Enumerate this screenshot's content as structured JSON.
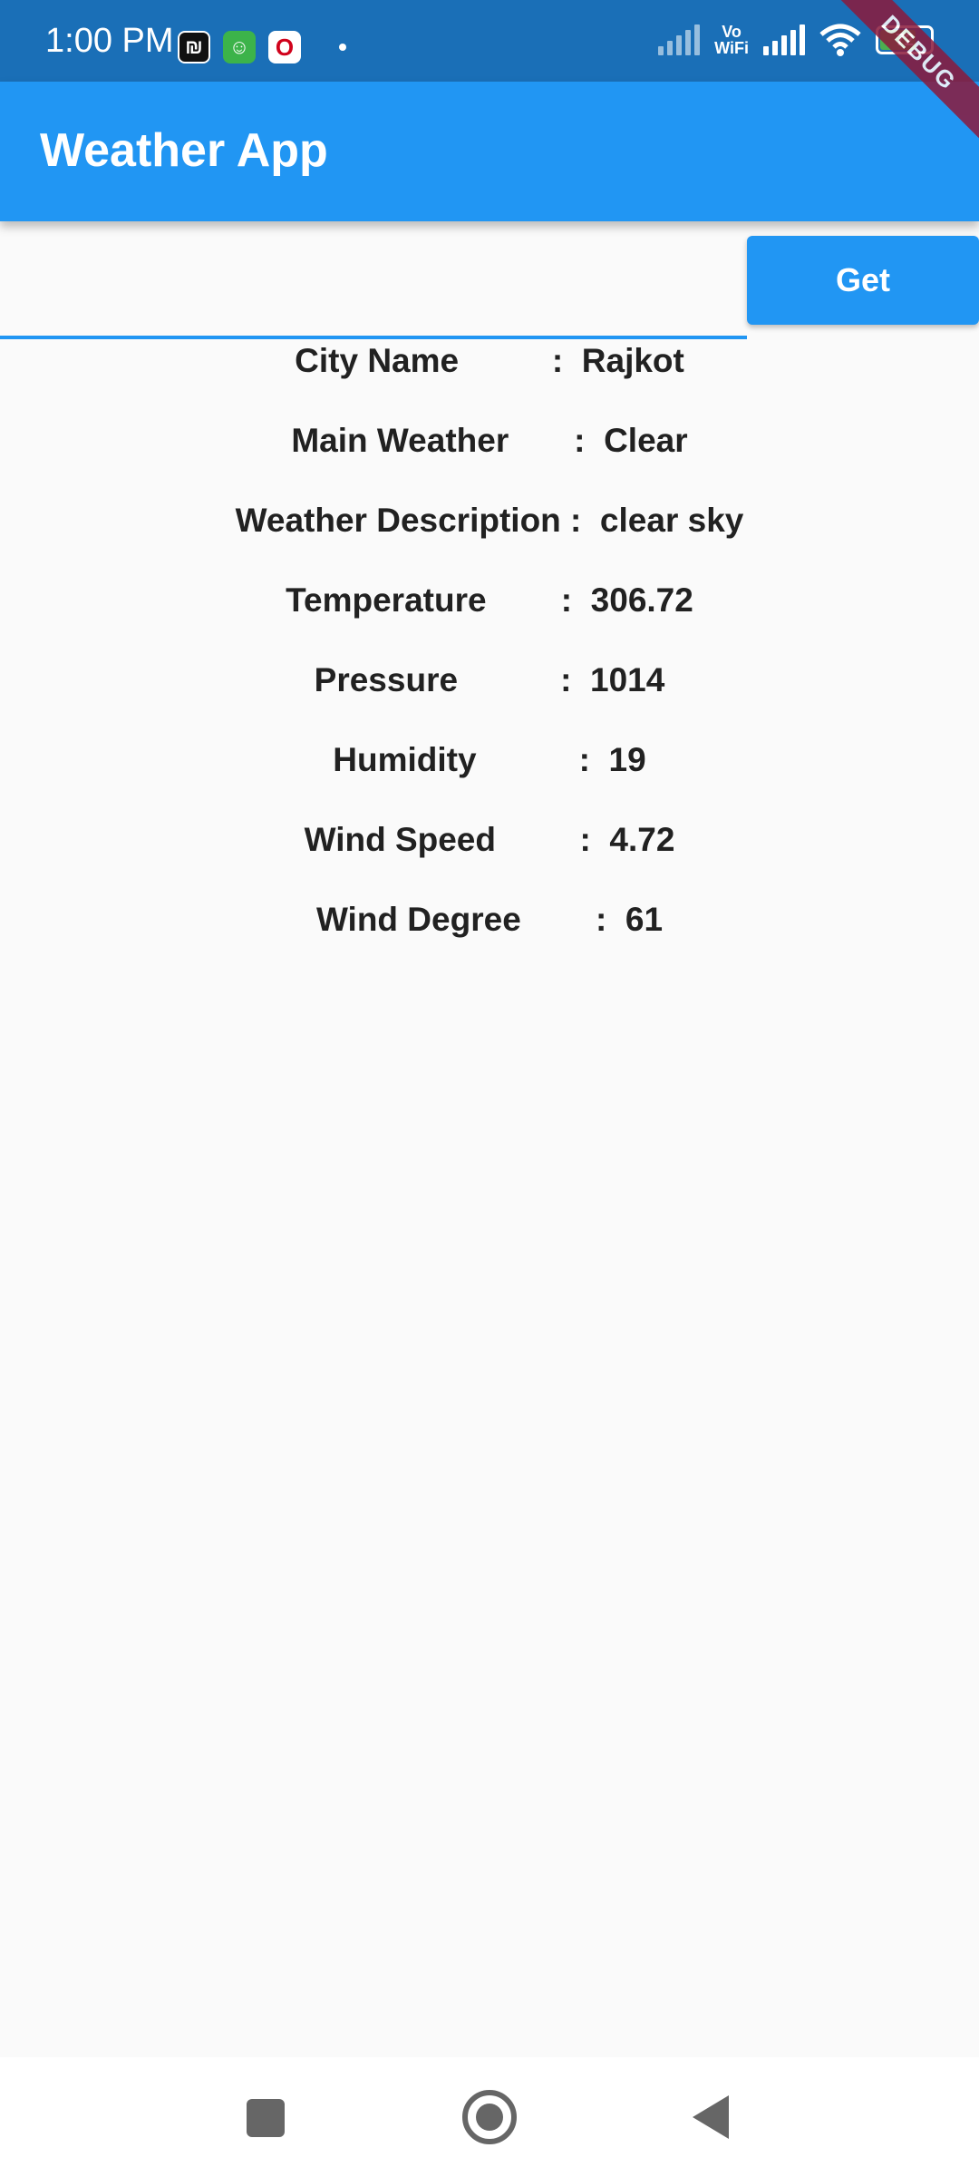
{
  "status_bar": {
    "time": "1:00 PM",
    "vowifi_top": "Vo",
    "vowifi_bottom": "WiFi",
    "battery": "72"
  },
  "debug_banner": "DEBUG",
  "app_bar": {
    "title": "Weather App"
  },
  "search": {
    "value": "",
    "placeholder": "",
    "button_label": "Get"
  },
  "weather": {
    "rows": [
      {
        "text": "City Name          :  Rajkot"
      },
      {
        "text": "Main Weather       :  Clear"
      },
      {
        "text": "Weather Description :  clear sky"
      },
      {
        "text": "Temperature        :  306.72"
      },
      {
        "text": "Pressure           :  1014"
      },
      {
        "text": "Humidity           :  19"
      },
      {
        "text": "Wind Speed         :  4.72"
      },
      {
        "text": "Wind Degree        :  61"
      }
    ]
  },
  "colors": {
    "status_bar": "#1a6fb7",
    "app_bar": "#2196f3",
    "accent": "#2196f3",
    "background": "#fafafa"
  },
  "icons": {
    "notifications": [
      "nfc-app-icon",
      "android-app-icon",
      "opera-icon"
    ],
    "system": [
      "signal-icon",
      "vowifi-icon",
      "signal-icon",
      "wifi-icon",
      "battery-icon"
    ],
    "navigation": [
      "recents-icon",
      "home-icon",
      "back-icon"
    ]
  }
}
